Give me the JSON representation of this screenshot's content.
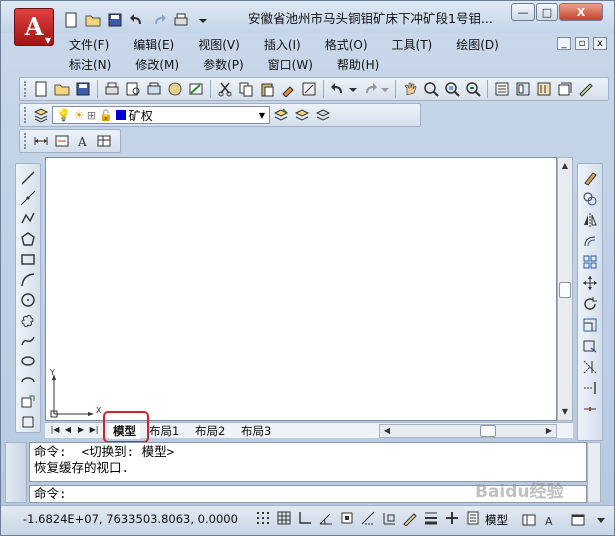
{
  "app": {
    "logo_letter": "A",
    "title": "安徽省池州市马头铜钼矿床下冲矿段1号钼..."
  },
  "window_controls": {
    "minimize": "—",
    "maximize": "□",
    "close": "X"
  },
  "menu": {
    "row1": [
      "文件(F)",
      "编辑(E)",
      "视图(V)",
      "插入(I)",
      "格式(O)",
      "工具(T)",
      "绘图(D)"
    ],
    "row2": [
      "标注(N)",
      "修改(M)",
      "参数(P)",
      "窗口(W)",
      "帮助(H)"
    ]
  },
  "layer": {
    "current": "矿权"
  },
  "tabs": [
    "模型",
    "布局1",
    "布局2",
    "布局3"
  ],
  "ucs": {
    "x_label": "X",
    "y_label": "Y"
  },
  "command": {
    "history_line1": "命令:  <切换到: 模型>",
    "history_line2": "恢复缓存的视口.",
    "prompt": "命令:"
  },
  "status": {
    "coordinates": "-1.6824E+07,  7633503.8063, 0.0000",
    "space": "模型"
  },
  "watermark": "Baidu经验",
  "colors": {
    "accent": "#c8262f",
    "layer_color": "#0000cc"
  }
}
